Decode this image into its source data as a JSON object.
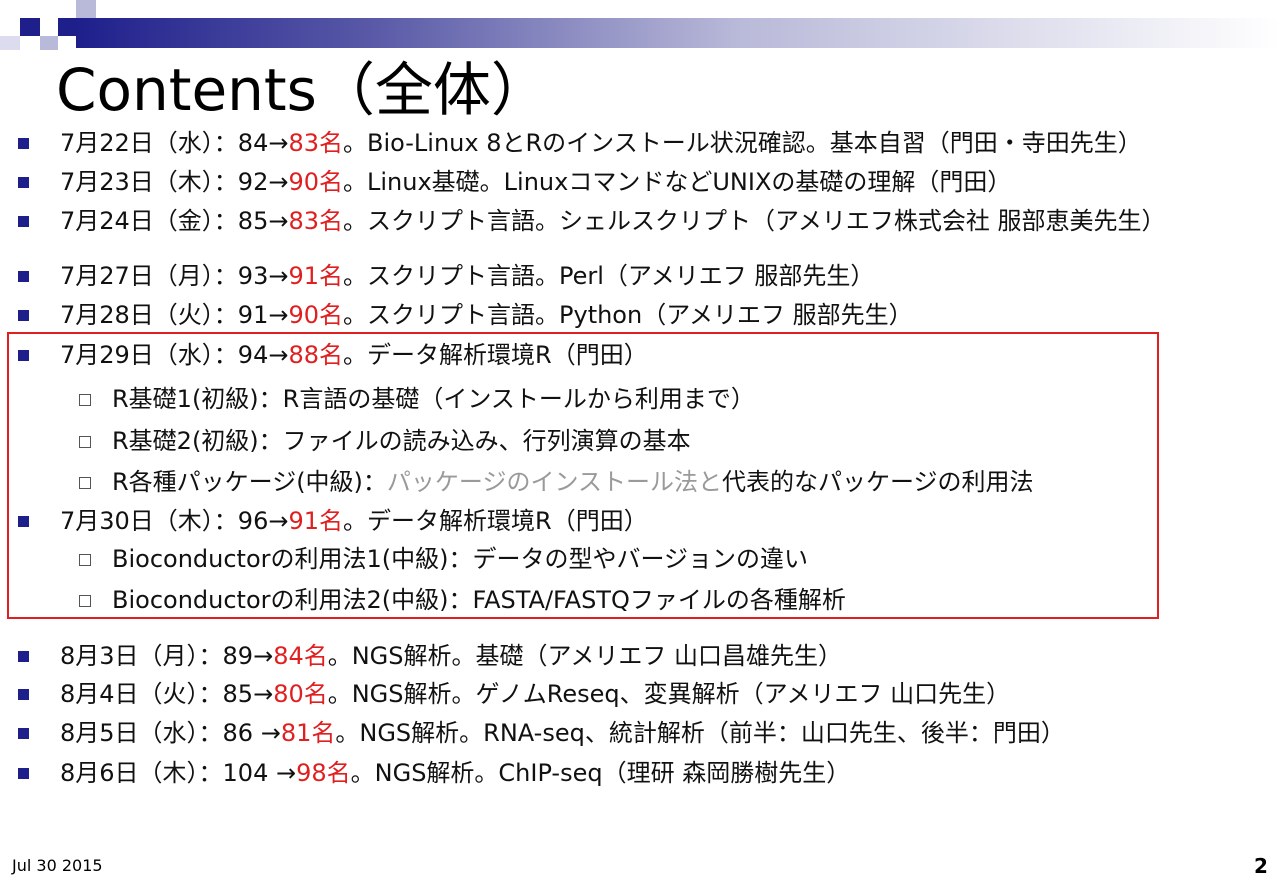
{
  "title": "Contents（全体）",
  "items": [
    {
      "head": "7月22日（水）：84→",
      "count": "83名",
      "rest": "。Bio-Linux 8とRのインストール状況確認。基本自習（門田・寺田先生）"
    },
    {
      "head": "7月23日（木）：92→",
      "count": "90名",
      "rest": "。Linux基礎。LinuxコマンドなどUNIXの基礎の理解（門田）"
    },
    {
      "head": "7月24日（金）：85→",
      "count": "83名",
      "rest": "。スクリプト言語。シェルスクリプト（アメリエフ株式会社 服部恵美先生）"
    },
    {
      "head": "7月27日（月）：93→",
      "count": "91名",
      "rest": "。スクリプト言語。Perl（アメリエフ 服部先生）"
    },
    {
      "head": "7月28日（火）：91→",
      "count": "90名",
      "rest": "。スクリプト言語。Python（アメリエフ 服部先生）"
    },
    {
      "head": "7月29日（水）：94→",
      "count": "88名",
      "rest": "。データ解析環境R（門田）"
    },
    {
      "head": "7月30日（木）：96→",
      "count": "91名",
      "rest": "。データ解析環境R（門田）"
    },
    {
      "head": "8月3日（月）：89→",
      "count": "84名",
      "rest": "。NGS解析。基礎（アメリエフ 山口昌雄先生）"
    },
    {
      "head": "8月4日（火）：85→",
      "count": "80名",
      "rest": "。NGS解析。ゲノムReseq、変異解析（アメリエフ 山口先生）"
    },
    {
      "head": "8月5日（水）：86 →",
      "count": "81名",
      "rest": "。NGS解析。RNA-seq、統計解析（前半：山口先生、後半：門田）"
    },
    {
      "head": "8月6日（木）：104 →",
      "count": "98名",
      "rest": "。NGS解析。ChIP-seq（理研 森岡勝樹先生）"
    }
  ],
  "subitems_0729": [
    {
      "text": "R基礎1(初級)：R言語の基礎（インストールから利用まで）"
    },
    {
      "text": "R基礎2(初級)：ファイルの読み込み、行列演算の基本"
    },
    {
      "lead": "R各種パッケージ(中級)：",
      "gray": "パッケージのインストール法と",
      "tail": "代表的なパッケージの利用法"
    }
  ],
  "subitems_0730": [
    {
      "text": "Bioconductorの利用法1(中級)：データの型やバージョンの違い"
    },
    {
      "text": "Bioconductorの利用法2(中級)：FASTA/FASTQファイルの各種解析"
    }
  ],
  "footer": {
    "date": "Jul 30 2015",
    "page": "2"
  },
  "colors": {
    "accent": "#1f1f8c",
    "highlight": "#e02020",
    "muted": "#9a9a9a"
  }
}
